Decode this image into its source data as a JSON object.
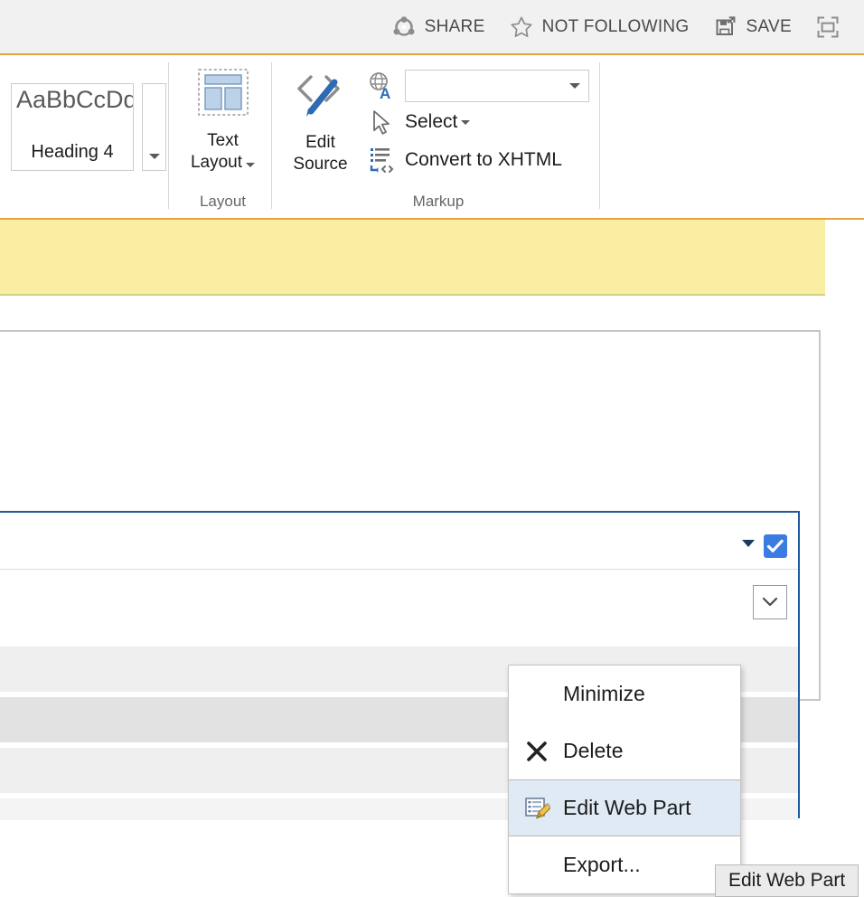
{
  "top_bar": {
    "actions": [
      {
        "label": "SHARE",
        "icon": "share-icon"
      },
      {
        "label": "NOT FOLLOWING",
        "icon": "star-outline-icon"
      },
      {
        "label": "SAVE",
        "icon": "save-icon"
      }
    ],
    "focus_button": {
      "icon": "focus-on-content-icon",
      "label": ""
    }
  },
  "ribbon": {
    "styles_group": {
      "label": "",
      "gallery_sample": "AaBbCcDdE",
      "gallery_style_name": "Heading 4",
      "scroll_icon": "chevron-down-icon"
    },
    "layout_group": {
      "label": "Layout",
      "text_layout_label": "Text\nLayout",
      "text_layout_line1": "Text",
      "text_layout_line2": "Layout",
      "icon": "text-layout-icon"
    },
    "markup_group": {
      "label": "Markup",
      "edit_source_line1": "Edit",
      "edit_source_line2": "Source",
      "edit_source_icon": "code-pencil-icon",
      "language_icon": "globe-a-icon",
      "markup_style_value": "",
      "markup_style_placeholder": "",
      "select_label": "Select",
      "select_icon": "cursor-arrow-icon",
      "convert_label": "Convert to XHTML",
      "convert_icon": "convert-xhtml-icon"
    }
  },
  "page": {
    "status_bar": {
      "text": "",
      "background": "#faeea2"
    },
    "webpart": {
      "menu_caret_icon": "caret-down-icon",
      "checkbox_icon": "checkmark-icon",
      "checkbox_checked": true,
      "checkbox_color": "#3a7ce1",
      "select_icon": "chevron-down-icon",
      "selection_border_color": "#205aa0"
    },
    "rows": [
      {
        "shade": "#efefef"
      },
      {
        "shade": "#e2e2e2"
      },
      {
        "shade": "#efefef"
      },
      {
        "shade": "#f4f4f4"
      }
    ]
  },
  "context_menu": {
    "items": [
      {
        "label": "Minimize",
        "icon": "",
        "highlighted": false
      },
      {
        "label": "Delete",
        "icon": "close-x-icon",
        "highlighted": false
      },
      {
        "label": "Edit Web Part",
        "icon": "edit-webpart-icon",
        "highlighted": true
      },
      {
        "label": "Export...",
        "icon": "",
        "highlighted": false
      }
    ]
  },
  "tooltip": {
    "text": "Edit Web Part"
  }
}
